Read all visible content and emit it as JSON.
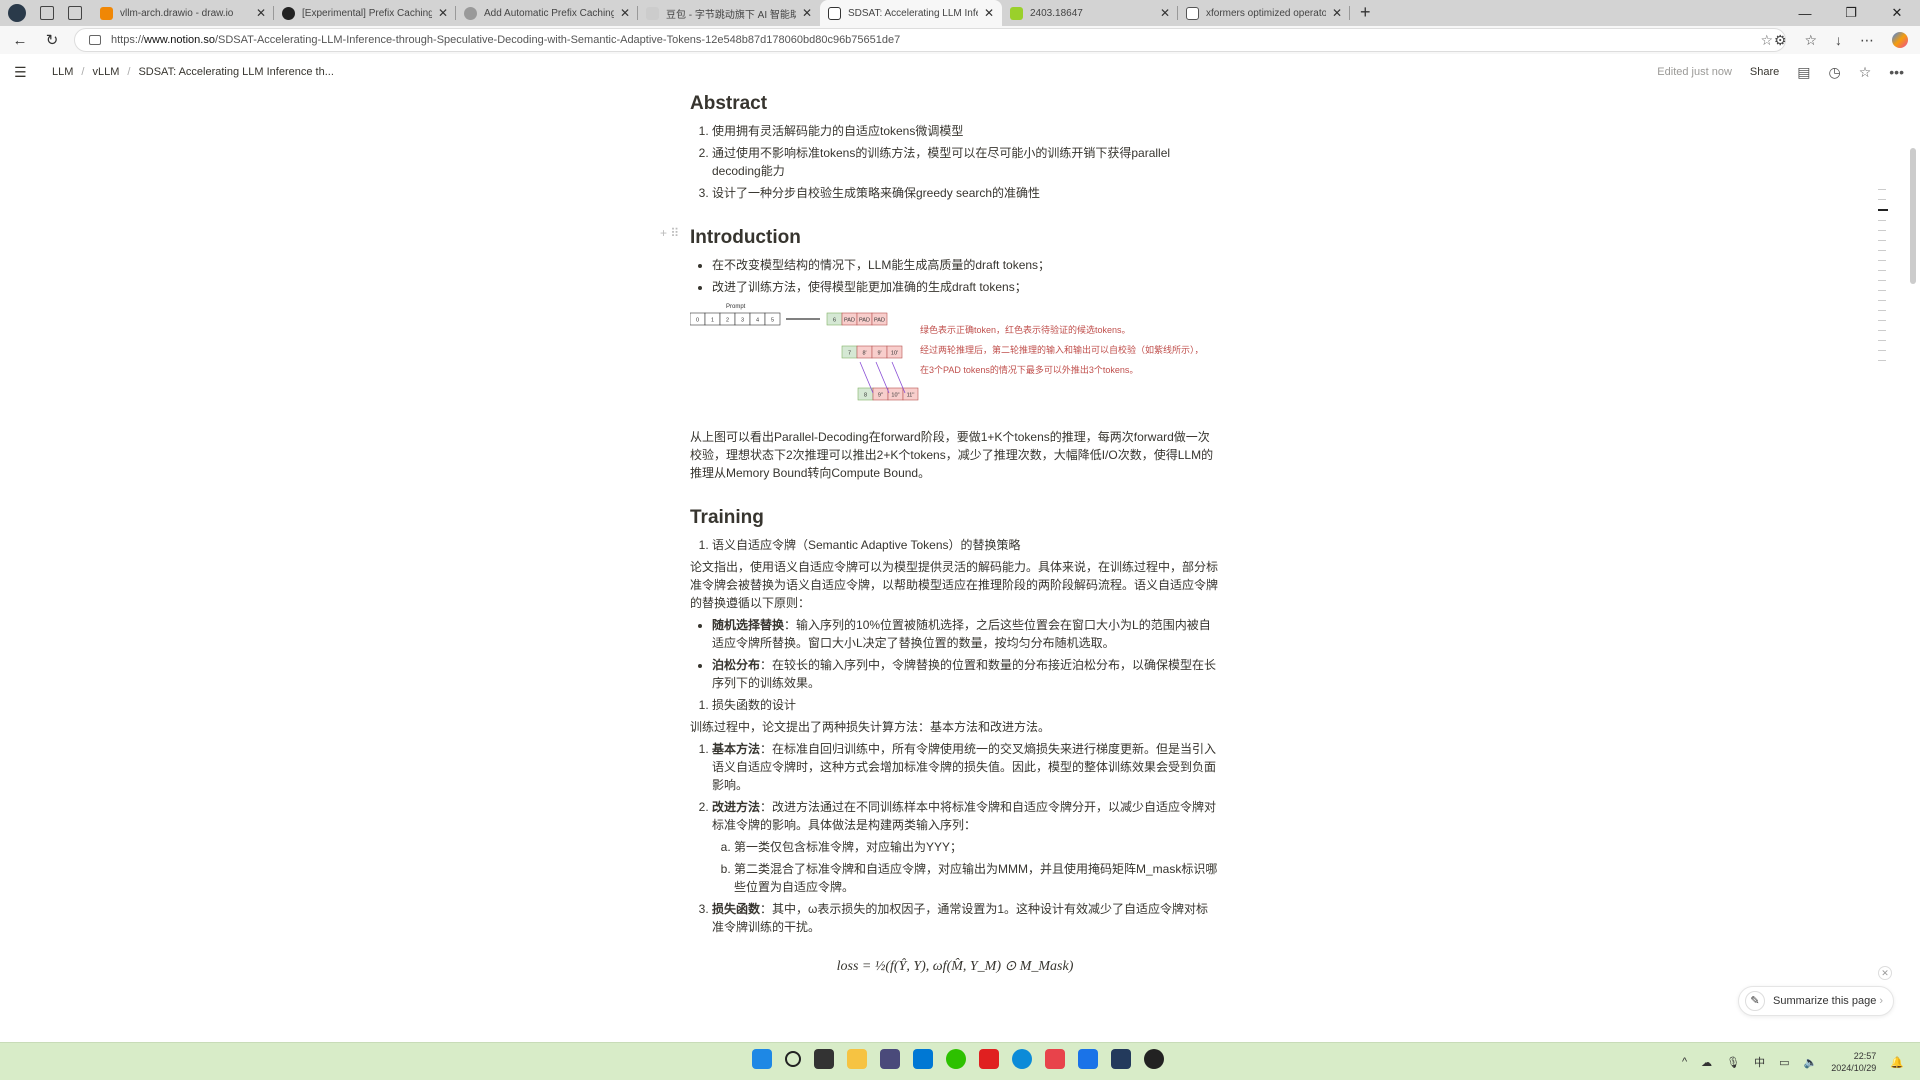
{
  "browser": {
    "tabs": [
      {
        "title": "vllm-arch.drawio - draw.io",
        "favicon": "drawio-icon",
        "color": "#f08705"
      },
      {
        "title": "[Experimental] Prefix Caching Sup",
        "favicon": "github-icon",
        "color": "#222222"
      },
      {
        "title": "Add Automatic Prefix Caching by",
        "favicon": "github-icon",
        "color": "#999999"
      },
      {
        "title": "豆包 - 字节跳动旗下 AI 智能助手",
        "favicon": "doubao-icon",
        "color": "#cccccc"
      },
      {
        "title": "SDSAT: Accelerating LLM Inferenc",
        "favicon": "notion-icon",
        "color": "#333333",
        "active": true
      },
      {
        "title": "2403.18647",
        "favicon": "arxiv-icon",
        "color": "#9ad02b"
      },
      {
        "title": "xformers optimized operators | xl",
        "favicon": "page-icon",
        "color": "#ffffff"
      }
    ],
    "url_prefix": "https://",
    "url_domain": "www.notion.so",
    "url_path": "/SDSAT-Accelerating-LLM-Inference-through-Speculative-Decoding-with-Semantic-Adaptive-Tokens-12e548b87d178060bd80c96b75651de7"
  },
  "notion": {
    "breadcrumb": [
      "LLM",
      "vLLM",
      "SDSAT: Accelerating LLM Inference th..."
    ],
    "edited": "Edited just now",
    "share": "Share"
  },
  "content": {
    "abstract": {
      "heading": "Abstract",
      "items": [
        "使用拥有灵活解码能力的自适应tokens微调模型",
        "通过使用不影响标准tokens的训练方法，模型可以在尽可能小的训练开销下获得parallel decoding能力",
        "设计了一种分步自校验生成策略来确保greedy search的准确性"
      ]
    },
    "introduction": {
      "heading": "Introduction",
      "bullets": [
        "在不改变模型结构的情况下，LLM能生成高质量的draft tokens；",
        "改进了训练方法，使得模型能更加准确的生成draft tokens；"
      ],
      "figure": {
        "prompt_label": "Prompt",
        "prompt_tokens": [
          "0",
          "1",
          "2",
          "3",
          "4",
          "5"
        ],
        "row1": [
          "6",
          "PAD",
          "PAD",
          "PAD"
        ],
        "row2": [
          "7",
          "8'",
          "9'",
          "10'"
        ],
        "row3": [
          "8",
          "9''",
          "10''",
          "11''"
        ],
        "check_label": "=?",
        "notes": [
          "绿色表示正确token，红色表示待验证的候选tokens。",
          "经过两轮推理后，第二轮推理的输入和输出可以自校验（如紫线所示），",
          "在3个PAD tokens的情况下最多可以外推出3个tokens。"
        ]
      },
      "paragraph": "从上图可以看出Parallel-Decoding在forward阶段，要做1+K个tokens的推理，每两次forward做一次校验，理想状态下2次推理可以推出2+K个tokens，减少了推理次数，大幅降低I/O次数，使得LLM的推理从Memory Bound转向Compute Bound。"
    },
    "training": {
      "heading": "Training",
      "item1": "语义自适应令牌（Semantic Adaptive Tokens）的替换策略",
      "para1": "论文指出，使用语义自适应令牌可以为模型提供灵活的解码能力。具体来说，在训练过程中，部分标准令牌会被替换为语义自适应令牌，以帮助模型适应在推理阶段的两阶段解码流程。语义自适应令牌的替换遵循以下原则：",
      "bullets": [
        {
          "bold": "随机选择替换",
          "text": "：输入序列的10%位置被随机选择，之后这些位置会在窗口大小为L的范围内被自适应令牌所替换。窗口大小L决定了替换位置的数量，按均匀分布随机选取。"
        },
        {
          "bold": "泊松分布",
          "text": "：在较长的输入序列中，令牌替换的位置和数量的分布接近泊松分布，以确保模型在长序列下的训练效果。"
        }
      ],
      "item2": "损失函数的设计",
      "para2": "训练过程中，论文提出了两种损失计算方法：基本方法和改进方法。",
      "methods": [
        {
          "bold": "基本方法",
          "text": "：在标准自回归训练中，所有令牌使用统一的交叉熵损失来进行梯度更新。但是当引入语义自适应令牌时，这种方式会增加标准令牌的损失值。因此，模型的整体训练效果会受到负面影响。"
        },
        {
          "bold": "改进方法",
          "text": "：改进方法通过在不同训练样本中将标准令牌和自适应令牌分开，以减少自适应令牌对标准令牌的影响。具体做法是构建两类输入序列："
        },
        {
          "bold": "损失函数",
          "text": "：其中，ω表示损失的加权因子，通常设置为1。这种设计有效减少了自适应令牌对标准令牌训练的干扰。"
        }
      ],
      "sub": [
        "第一类仅包含标准令牌，对应输出为YYY；",
        "第二类混合了标准令牌和自适应令牌，对应输出为MMM，并且使用掩码矩阵M_mask标识哪些位置为自适应令牌。"
      ],
      "formula": "loss = ½(f(Ŷ, Y), ωf(M̂, Y_M) ⊙ M_Mask)"
    }
  },
  "summarize": "Summarize this page",
  "taskbar": {
    "time": "22:57",
    "date": "2024/10/29",
    "ime": "中"
  }
}
